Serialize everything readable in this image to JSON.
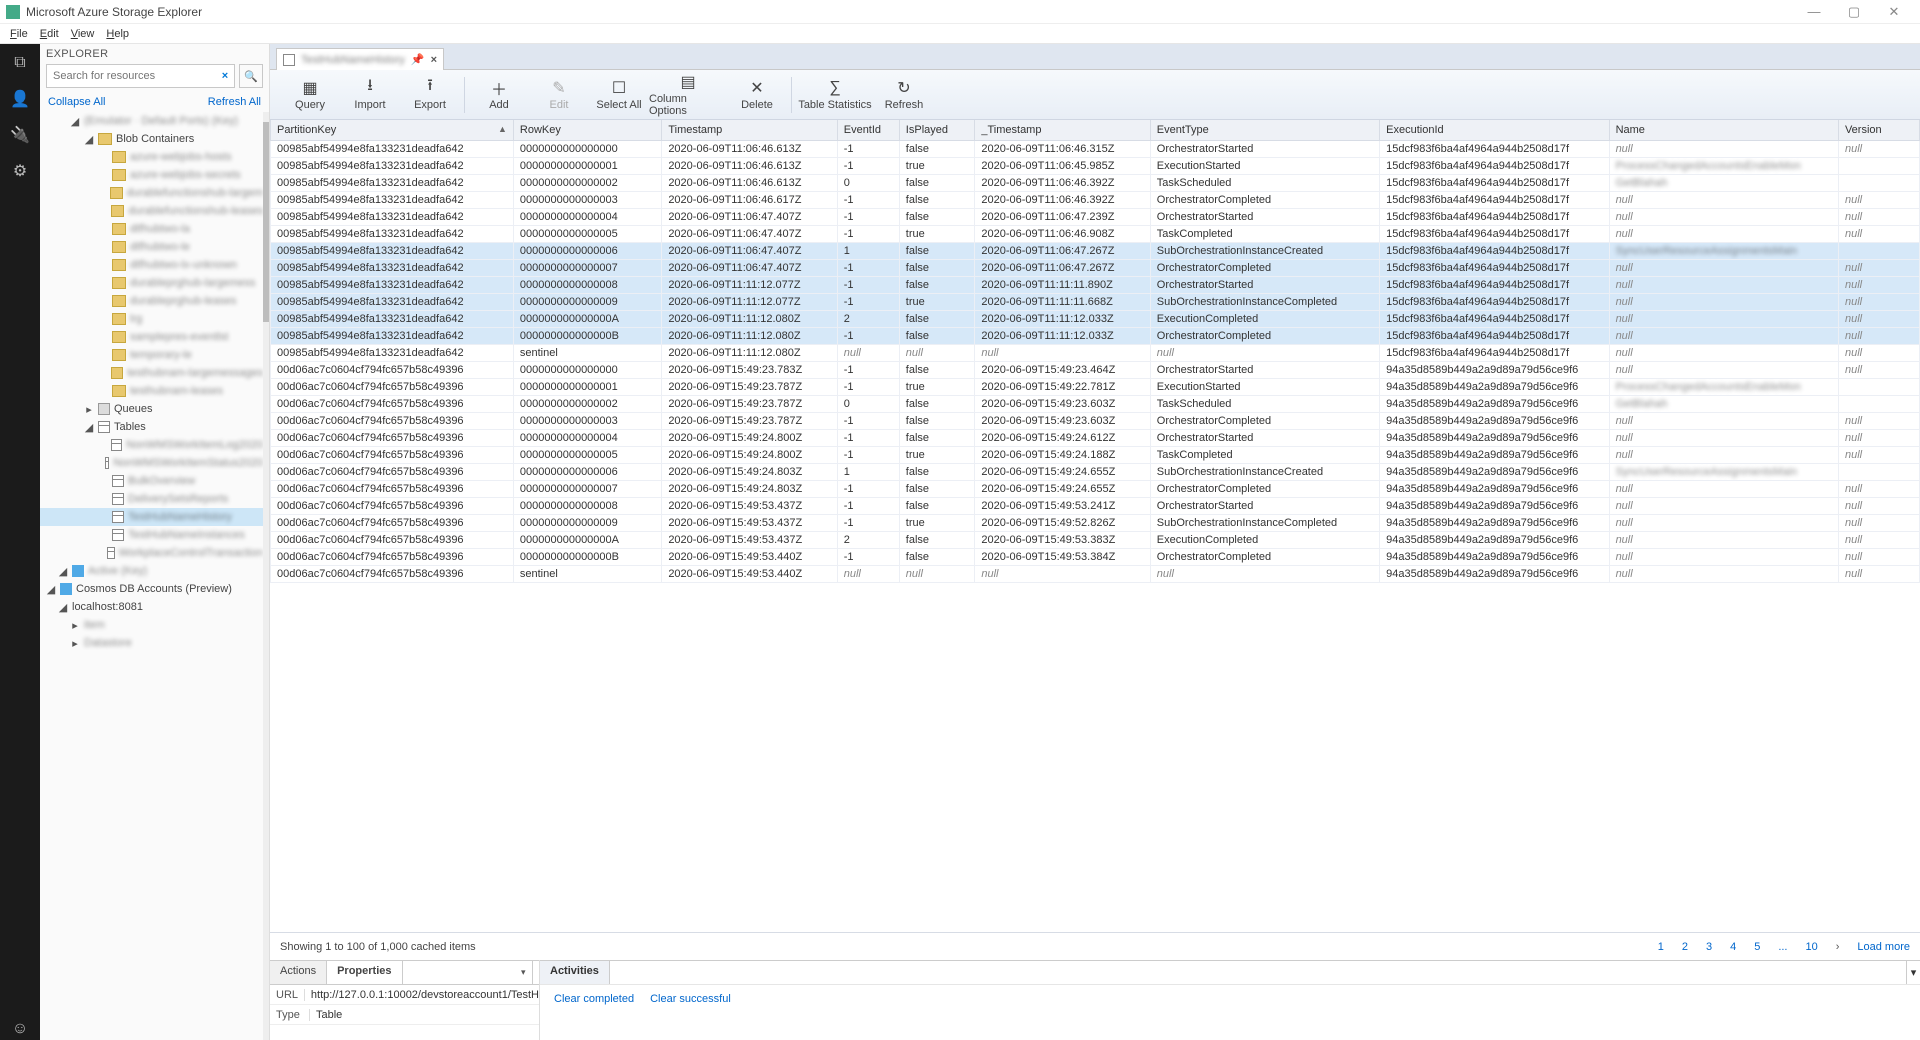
{
  "app": {
    "title": "Microsoft Azure Storage Explorer"
  },
  "menus": [
    "File",
    "Edit",
    "View",
    "Help"
  ],
  "window": {
    "min": "—",
    "max": "▢",
    "close": "✕"
  },
  "explorer": {
    "header": "EXPLORER",
    "search_placeholder": "Search for resources",
    "collapse": "Collapse All",
    "refresh": "Refresh All"
  },
  "tree": {
    "emulator": "(Emulator · Default Ports) (Key)",
    "blob": "Blob Containers",
    "queues": "Queues",
    "tables": "Tables",
    "cosmos": "Cosmos DB Accounts (Preview)",
    "localhost": "localhost:8081",
    "blob_items": [
      "azure-webjobs-hosts",
      "azure-webjobs-secrets",
      "durablefunctionshub-largem",
      "durablefunctionshub-leases",
      "dtfhubtwo-la",
      "dtfhubtwo-le",
      "dtfhubtwo-lx-unknown",
      "durableprghub-largemess",
      "durableprghub-leases",
      "lrg",
      "samplepres-eventlst",
      "temporary-le",
      "testhubnam-largemessages",
      "testhubnam-leases"
    ],
    "table_items": [
      "NonWMSWorkItemLog2020",
      "NonWMSWorkItemStatus2020",
      "BulkOverview",
      "DeliverySetsReports",
      "TestHubNameHistory",
      "TestHubNameInstances",
      "WorkplaceControlTransaction"
    ],
    "table_selected_index": 4
  },
  "tab": {
    "name": "TestHubNameHistory"
  },
  "toolbar": [
    {
      "id": "query",
      "label": "Query",
      "glyph": "▦"
    },
    {
      "id": "import",
      "label": "Import",
      "glyph": "⭳"
    },
    {
      "id": "export",
      "label": "Export",
      "glyph": "⭱"
    },
    {
      "sep": true
    },
    {
      "id": "add",
      "label": "Add",
      "glyph": "＋"
    },
    {
      "id": "edit",
      "label": "Edit",
      "glyph": "✎",
      "disabled": true
    },
    {
      "id": "selectall",
      "label": "Select All",
      "glyph": "☐"
    },
    {
      "id": "columnopts",
      "label": "Column Options",
      "glyph": "▤",
      "wide": true
    },
    {
      "id": "delete",
      "label": "Delete",
      "glyph": "✕"
    },
    {
      "sep": true
    },
    {
      "id": "tablestats",
      "label": "Table Statistics",
      "glyph": "∑",
      "wide": true
    },
    {
      "id": "refresh",
      "label": "Refresh",
      "glyph": "↻"
    }
  ],
  "columns": [
    "PartitionKey",
    "RowKey",
    "Timestamp",
    "EventId",
    "IsPlayed",
    "_Timestamp",
    "EventType",
    "ExecutionId",
    "Name",
    "Version"
  ],
  "sort_col": "PartitionKey",
  "rows": [
    {
      "pk": "00985abf54994e8fa133231deadfa642",
      "rk": "0000000000000000",
      "ts": "2020-06-09T11:06:46.613Z",
      "ei": "-1",
      "ip": "false",
      "ts2": "2020-06-09T11:06:46.315Z",
      "et": "OrchestratorStarted",
      "ex": "15dcf983f6ba4af4964a944b2508d17f",
      "nm": "null",
      "vr": "null"
    },
    {
      "pk": "00985abf54994e8fa133231deadfa642",
      "rk": "0000000000000001",
      "ts": "2020-06-09T11:06:46.613Z",
      "ei": "-1",
      "ip": "true",
      "ts2": "2020-06-09T11:06:45.985Z",
      "et": "ExecutionStarted",
      "ex": "15dcf983f6ba4af4964a944b2508d17f",
      "nm": "ProcessChangedAccountsEnableMon",
      "vr": ""
    },
    {
      "pk": "00985abf54994e8fa133231deadfa642",
      "rk": "0000000000000002",
      "ts": "2020-06-09T11:06:46.613Z",
      "ei": "0",
      "ip": "false",
      "ts2": "2020-06-09T11:06:46.392Z",
      "et": "TaskScheduled",
      "ex": "15dcf983f6ba4af4964a944b2508d17f",
      "nm": "GetBlahah",
      "vr": ""
    },
    {
      "pk": "00985abf54994e8fa133231deadfa642",
      "rk": "0000000000000003",
      "ts": "2020-06-09T11:06:46.617Z",
      "ei": "-1",
      "ip": "false",
      "ts2": "2020-06-09T11:06:46.392Z",
      "et": "OrchestratorCompleted",
      "ex": "15dcf983f6ba4af4964a944b2508d17f",
      "nm": "null",
      "vr": "null"
    },
    {
      "pk": "00985abf54994e8fa133231deadfa642",
      "rk": "0000000000000004",
      "ts": "2020-06-09T11:06:47.407Z",
      "ei": "-1",
      "ip": "false",
      "ts2": "2020-06-09T11:06:47.239Z",
      "et": "OrchestratorStarted",
      "ex": "15dcf983f6ba4af4964a944b2508d17f",
      "nm": "null",
      "vr": "null"
    },
    {
      "pk": "00985abf54994e8fa133231deadfa642",
      "rk": "0000000000000005",
      "ts": "2020-06-09T11:06:47.407Z",
      "ei": "-1",
      "ip": "true",
      "ts2": "2020-06-09T11:06:46.908Z",
      "et": "TaskCompleted",
      "ex": "15dcf983f6ba4af4964a944b2508d17f",
      "nm": "null",
      "vr": "null"
    },
    {
      "hl": true,
      "pk": "00985abf54994e8fa133231deadfa642",
      "rk": "0000000000000006",
      "ts": "2020-06-09T11:06:47.407Z",
      "ei": "1",
      "ip": "false",
      "ts2": "2020-06-09T11:06:47.267Z",
      "et": "SubOrchestrationInstanceCreated",
      "ex": "15dcf983f6ba4af4964a944b2508d17f",
      "nm": "SyncUserResourceAssignmentsMain",
      "vr": ""
    },
    {
      "hl": true,
      "pk": "00985abf54994e8fa133231deadfa642",
      "rk": "0000000000000007",
      "ts": "2020-06-09T11:06:47.407Z",
      "ei": "-1",
      "ip": "false",
      "ts2": "2020-06-09T11:06:47.267Z",
      "et": "OrchestratorCompleted",
      "ex": "15dcf983f6ba4af4964a944b2508d17f",
      "nm": "null",
      "vr": "null"
    },
    {
      "hl": true,
      "pk": "00985abf54994e8fa133231deadfa642",
      "rk": "0000000000000008",
      "ts": "2020-06-09T11:11:12.077Z",
      "ei": "-1",
      "ip": "false",
      "ts2": "2020-06-09T11:11:11.890Z",
      "et": "OrchestratorStarted",
      "ex": "15dcf983f6ba4af4964a944b2508d17f",
      "nm": "null",
      "vr": "null"
    },
    {
      "hl": true,
      "pk": "00985abf54994e8fa133231deadfa642",
      "rk": "0000000000000009",
      "ts": "2020-06-09T11:11:12.077Z",
      "ei": "-1",
      "ip": "true",
      "ts2": "2020-06-09T11:11:11.668Z",
      "et": "SubOrchestrationInstanceCompleted",
      "ex": "15dcf983f6ba4af4964a944b2508d17f",
      "nm": "null",
      "vr": "null"
    },
    {
      "hl": true,
      "pk": "00985abf54994e8fa133231deadfa642",
      "rk": "000000000000000A",
      "ts": "2020-06-09T11:11:12.080Z",
      "ei": "2",
      "ip": "false",
      "ts2": "2020-06-09T11:11:12.033Z",
      "et": "ExecutionCompleted",
      "ex": "15dcf983f6ba4af4964a944b2508d17f",
      "nm": "null",
      "vr": "null"
    },
    {
      "hl": true,
      "pk": "00985abf54994e8fa133231deadfa642",
      "rk": "000000000000000B",
      "ts": "2020-06-09T11:11:12.080Z",
      "ei": "-1",
      "ip": "false",
      "ts2": "2020-06-09T11:11:12.033Z",
      "et": "OrchestratorCompleted",
      "ex": "15dcf983f6ba4af4964a944b2508d17f",
      "nm": "null",
      "vr": "null"
    },
    {
      "pk": "00985abf54994e8fa133231deadfa642",
      "rk": "sentinel",
      "ts": "2020-06-09T11:11:12.080Z",
      "ei": "null",
      "ip": "null",
      "ts2": "null",
      "et": "null",
      "ex": "15dcf983f6ba4af4964a944b2508d17f",
      "nm": "null",
      "vr": "null"
    },
    {
      "pk": "00d06ac7c0604cf794fc657b58c49396",
      "rk": "0000000000000000",
      "ts": "2020-06-09T15:49:23.783Z",
      "ei": "-1",
      "ip": "false",
      "ts2": "2020-06-09T15:49:23.464Z",
      "et": "OrchestratorStarted",
      "ex": "94a35d8589b449a2a9d89a79d56ce9f6",
      "nm": "null",
      "vr": "null"
    },
    {
      "pk": "00d06ac7c0604cf794fc657b58c49396",
      "rk": "0000000000000001",
      "ts": "2020-06-09T15:49:23.787Z",
      "ei": "-1",
      "ip": "true",
      "ts2": "2020-06-09T15:49:22.781Z",
      "et": "ExecutionStarted",
      "ex": "94a35d8589b449a2a9d89a79d56ce9f6",
      "nm": "ProcessChangedAccountsEnableMon",
      "vr": ""
    },
    {
      "pk": "00d06ac7c0604cf794fc657b58c49396",
      "rk": "0000000000000002",
      "ts": "2020-06-09T15:49:23.787Z",
      "ei": "0",
      "ip": "false",
      "ts2": "2020-06-09T15:49:23.603Z",
      "et": "TaskScheduled",
      "ex": "94a35d8589b449a2a9d89a79d56ce9f6",
      "nm": "GetBlahah",
      "vr": ""
    },
    {
      "pk": "00d06ac7c0604cf794fc657b58c49396",
      "rk": "0000000000000003",
      "ts": "2020-06-09T15:49:23.787Z",
      "ei": "-1",
      "ip": "false",
      "ts2": "2020-06-09T15:49:23.603Z",
      "et": "OrchestratorCompleted",
      "ex": "94a35d8589b449a2a9d89a79d56ce9f6",
      "nm": "null",
      "vr": "null"
    },
    {
      "pk": "00d06ac7c0604cf794fc657b58c49396",
      "rk": "0000000000000004",
      "ts": "2020-06-09T15:49:24.800Z",
      "ei": "-1",
      "ip": "false",
      "ts2": "2020-06-09T15:49:24.612Z",
      "et": "OrchestratorStarted",
      "ex": "94a35d8589b449a2a9d89a79d56ce9f6",
      "nm": "null",
      "vr": "null"
    },
    {
      "pk": "00d06ac7c0604cf794fc657b58c49396",
      "rk": "0000000000000005",
      "ts": "2020-06-09T15:49:24.800Z",
      "ei": "-1",
      "ip": "true",
      "ts2": "2020-06-09T15:49:24.188Z",
      "et": "TaskCompleted",
      "ex": "94a35d8589b449a2a9d89a79d56ce9f6",
      "nm": "null",
      "vr": "null"
    },
    {
      "pk": "00d06ac7c0604cf794fc657b58c49396",
      "rk": "0000000000000006",
      "ts": "2020-06-09T15:49:24.803Z",
      "ei": "1",
      "ip": "false",
      "ts2": "2020-06-09T15:49:24.655Z",
      "et": "SubOrchestrationInstanceCreated",
      "ex": "94a35d8589b449a2a9d89a79d56ce9f6",
      "nm": "SyncUserResourceAssignmentsMain",
      "vr": ""
    },
    {
      "pk": "00d06ac7c0604cf794fc657b58c49396",
      "rk": "0000000000000007",
      "ts": "2020-06-09T15:49:24.803Z",
      "ei": "-1",
      "ip": "false",
      "ts2": "2020-06-09T15:49:24.655Z",
      "et": "OrchestratorCompleted",
      "ex": "94a35d8589b449a2a9d89a79d56ce9f6",
      "nm": "null",
      "vr": "null"
    },
    {
      "pk": "00d06ac7c0604cf794fc657b58c49396",
      "rk": "0000000000000008",
      "ts": "2020-06-09T15:49:53.437Z",
      "ei": "-1",
      "ip": "false",
      "ts2": "2020-06-09T15:49:53.241Z",
      "et": "OrchestratorStarted",
      "ex": "94a35d8589b449a2a9d89a79d56ce9f6",
      "nm": "null",
      "vr": "null"
    },
    {
      "pk": "00d06ac7c0604cf794fc657b58c49396",
      "rk": "0000000000000009",
      "ts": "2020-06-09T15:49:53.437Z",
      "ei": "-1",
      "ip": "true",
      "ts2": "2020-06-09T15:49:52.826Z",
      "et": "SubOrchestrationInstanceCompleted",
      "ex": "94a35d8589b449a2a9d89a79d56ce9f6",
      "nm": "null",
      "vr": "null"
    },
    {
      "pk": "00d06ac7c0604cf794fc657b58c49396",
      "rk": "000000000000000A",
      "ts": "2020-06-09T15:49:53.437Z",
      "ei": "2",
      "ip": "false",
      "ts2": "2020-06-09T15:49:53.383Z",
      "et": "ExecutionCompleted",
      "ex": "94a35d8589b449a2a9d89a79d56ce9f6",
      "nm": "null",
      "vr": "null"
    },
    {
      "pk": "00d06ac7c0604cf794fc657b58c49396",
      "rk": "000000000000000B",
      "ts": "2020-06-09T15:49:53.440Z",
      "ei": "-1",
      "ip": "false",
      "ts2": "2020-06-09T15:49:53.384Z",
      "et": "OrchestratorCompleted",
      "ex": "94a35d8589b449a2a9d89a79d56ce9f6",
      "nm": "null",
      "vr": "null"
    },
    {
      "pk": "00d06ac7c0604cf794fc657b58c49396",
      "rk": "sentinel",
      "ts": "2020-06-09T15:49:53.440Z",
      "ei": "null",
      "ip": "null",
      "ts2": "null",
      "et": "null",
      "ex": "94a35d8589b449a2a9d89a79d56ce9f6",
      "nm": "null",
      "vr": "null"
    }
  ],
  "footer": {
    "status": "Showing 1 to 100 of 1,000 cached items",
    "pages": [
      "1",
      "2",
      "3",
      "4",
      "5",
      "...",
      "10"
    ],
    "loadmore": "Load more"
  },
  "bottom": {
    "tab_actions": "Actions",
    "tab_properties": "Properties",
    "url_label": "URL",
    "url_value": "http://127.0.0.1:10002/devstoreaccount1/TestH",
    "type_label": "Type",
    "type_value": "Table"
  },
  "activities": {
    "tab": "Activities",
    "clear_completed": "Clear completed",
    "clear_successful": "Clear successful"
  }
}
